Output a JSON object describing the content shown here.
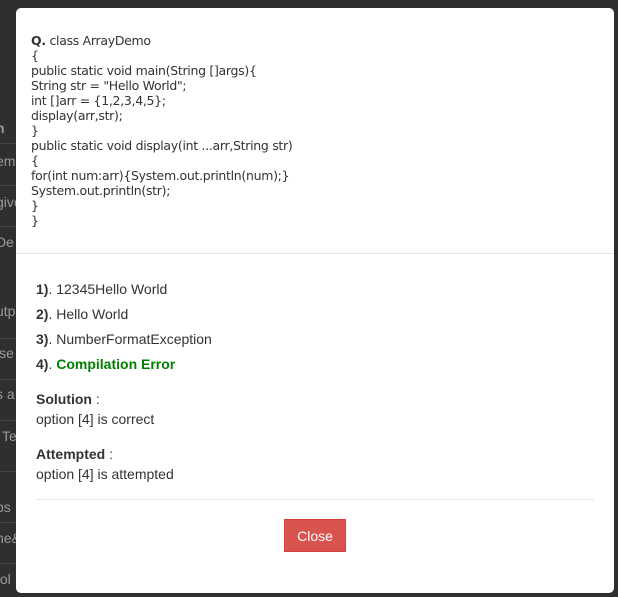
{
  "background": {
    "fragments": [
      "n",
      "em",
      "give",
      "De",
      "utp",
      "ise",
      "s a",
      "Te",
      "bs",
      "ne&",
      "fol"
    ]
  },
  "question": {
    "prefix": "Q.",
    "lines": [
      "class ArrayDemo",
      "{",
      "public static void main(String []args){",
      "String str = \"Hello World\";",
      "int []arr = {1,2,3,4,5};",
      "display(arr,str);",
      "}",
      "public static void display(int ...arr,String str)",
      "{",
      "for(int num:arr){System.out.println(num);}",
      "System.out.println(str);",
      "}",
      "}"
    ]
  },
  "options": [
    {
      "num": "1)",
      "text": "12345Hello World"
    },
    {
      "num": "2)",
      "text": "Hello World"
    },
    {
      "num": "3)",
      "text": "NumberFormatException"
    },
    {
      "num": "4)",
      "text": "Compilation Error"
    }
  ],
  "solution": {
    "label": "Solution",
    "text": "option [4] is correct"
  },
  "attempted": {
    "label": "Attempted",
    "text": "option [4] is attempted"
  },
  "footer": {
    "close_label": "Close"
  },
  "colors": {
    "correct": "#008000",
    "close_button": "#d9534f"
  }
}
